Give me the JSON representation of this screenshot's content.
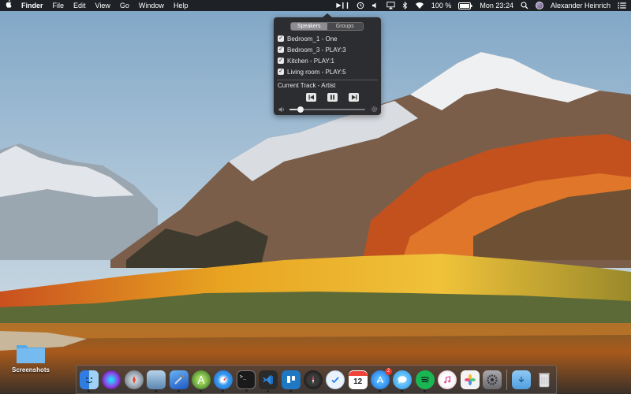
{
  "menubar": {
    "apple_icon": "apple-logo-icon",
    "app_name": "Finder",
    "menus": [
      "File",
      "Edit",
      "View",
      "Go",
      "Window",
      "Help"
    ],
    "playpause_glyph": "▶❙❙",
    "battery_text": "100 %",
    "clock": "Mon 23:24",
    "user_name": "Alexander Heinrich"
  },
  "popover": {
    "tabs": [
      {
        "label": "Speakers",
        "selected": true
      },
      {
        "label": "Groups",
        "selected": false
      }
    ],
    "speakers": [
      {
        "label": "Bedroom_1 - One",
        "checked": true
      },
      {
        "label": "Bedroom_3 - PLAY:3",
        "checked": true
      },
      {
        "label": "Kitchen - PLAY:1",
        "checked": true
      },
      {
        "label": "Living room - PLAY:5",
        "checked": true
      }
    ],
    "current_track": "Current Track - Artist",
    "volume_percent": 15,
    "check_glyph": "✓"
  },
  "desktop": {
    "icon_label": "Screenshots"
  },
  "dock": {
    "apps": [
      {
        "name": "Finder",
        "icon": "finder-icon",
        "color": "#3c8ae8",
        "running": true
      },
      {
        "name": "Siri",
        "icon": "siri-icon",
        "color": "#6a3fb8",
        "running": false
      },
      {
        "name": "Launchpad",
        "icon": "launchpad-icon",
        "color": "#7d8a96",
        "running": false
      },
      {
        "name": "Preview",
        "icon": "preview-icon",
        "color": "#6b8fb3",
        "running": true
      },
      {
        "name": "Xcode",
        "icon": "xcode-icon",
        "color": "#2c6fd6",
        "running": true
      },
      {
        "name": "Android Studio",
        "icon": "android-studio-icon",
        "color": "#6fb33c",
        "running": true
      },
      {
        "name": "Safari",
        "icon": "safari-icon",
        "color": "#2f8fe8",
        "running": true
      },
      {
        "name": "Terminal",
        "icon": "terminal-icon",
        "color": "#1d1d1d",
        "running": true
      },
      {
        "name": "Visual Studio Code",
        "icon": "vscode-icon",
        "color": "#1f6fc0",
        "running": true
      },
      {
        "name": "Trello",
        "icon": "trello-icon",
        "color": "#1f78c4",
        "running": true
      },
      {
        "name": "Compass",
        "icon": "compass-icon",
        "color": "#2a2a2a",
        "running": false
      },
      {
        "name": "Things",
        "icon": "things-icon",
        "color": "#e9f2fb",
        "running": false
      },
      {
        "name": "Calendar",
        "icon": "calendar-icon",
        "color": "#ffffff",
        "running": false
      },
      {
        "name": "App Store",
        "icon": "app-store-icon",
        "color": "#2a8bea",
        "running": true,
        "badge": "2"
      },
      {
        "name": "Messages",
        "icon": "messages-icon",
        "color": "#35a9f0",
        "running": true
      },
      {
        "name": "Spotify",
        "icon": "spotify-icon",
        "color": "#1ab654",
        "running": true
      },
      {
        "name": "iTunes",
        "icon": "itunes-icon",
        "color": "#f7f7f7",
        "running": false
      },
      {
        "name": "Photos",
        "icon": "photos-icon",
        "color": "#f3f3f3",
        "running": false
      },
      {
        "name": "System Preferences",
        "icon": "system-preferences-icon",
        "color": "#8a8a8e",
        "running": false
      }
    ],
    "right_items": [
      {
        "name": "Downloads",
        "icon": "downloads-folder-icon",
        "color": "#6aaee8"
      },
      {
        "name": "Trash",
        "icon": "trash-icon",
        "color": "#c9c9cc"
      }
    ],
    "calendar_day": "12"
  }
}
